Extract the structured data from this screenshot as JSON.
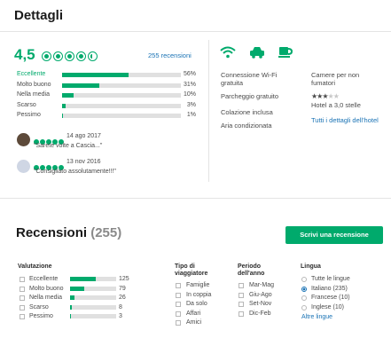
{
  "details": {
    "title": "Dettagli",
    "rating_value": "4,5",
    "rating_bubbles": 4.5,
    "reviews_count_link": "255 recensioni",
    "breakdown": [
      {
        "label": "Eccellente",
        "percent": "56%",
        "fraction": 0.56
      },
      {
        "label": "Molto buono",
        "percent": "31%",
        "fraction": 0.31
      },
      {
        "label": "Nella media",
        "percent": "10%",
        "fraction": 0.1
      },
      {
        "label": "Scarso",
        "percent": "3%",
        "fraction": 0.03
      },
      {
        "label": "Pessimo",
        "percent": "1%",
        "fraction": 0.01
      }
    ],
    "snippets": [
      {
        "date": "14 ago 2017",
        "quote": "\"Sarete volte a Cascia...\"",
        "rating": 5
      },
      {
        "date": "13 nov 2016",
        "quote": "\"Consigliato assolutamente!!!\"",
        "rating": 5
      }
    ],
    "amenity_icons": [
      "wifi-icon",
      "car-icon",
      "coffee-cup-icon"
    ],
    "amenities_left": [
      "Connessione Wi-Fi gratuita",
      "Parcheggio gratuito",
      "Colazione inclusa",
      "Aria condizionata"
    ],
    "amenities_right": [
      "Camere per non fumatori"
    ],
    "hotel_stars": 3,
    "hotel_class": "Hotel a 3,0 stelle",
    "all_details_link": "Tutti i dettagli dell'hotel"
  },
  "reviews": {
    "title": "Recensioni",
    "count": "(255)",
    "write_button": "Scrivi una recensione",
    "valutazione": {
      "header": "Valutazione",
      "items": [
        {
          "label": "Eccellente",
          "count": "125",
          "fraction": 0.56
        },
        {
          "label": "Molto buono",
          "count": "79",
          "fraction": 0.31
        },
        {
          "label": "Nella media",
          "count": "26",
          "fraction": 0.1
        },
        {
          "label": "Scarso",
          "count": "8",
          "fraction": 0.03
        },
        {
          "label": "Pessimo",
          "count": "3",
          "fraction": 0.01
        }
      ]
    },
    "tipo": {
      "header_line1": "Tipo di",
      "header_line2": "viaggiatore",
      "items": [
        "Famiglie",
        "In coppia",
        "Da solo",
        "Affari",
        "Amici"
      ]
    },
    "periodo": {
      "header_line1": "Periodo",
      "header_line2": "dell'anno",
      "items": [
        "Mar-Mag",
        "Giu-Ago",
        "Set-Nov",
        "Dic-Feb"
      ]
    },
    "lingua": {
      "header": "Lingua",
      "items": [
        {
          "label": "Tutte le lingue",
          "selected": false
        },
        {
          "label": "Italiano (235)",
          "selected": true
        },
        {
          "label": "Francese (10)",
          "selected": false
        },
        {
          "label": "Inglese (10)",
          "selected": false
        }
      ],
      "more_link": "Altre lingue"
    }
  },
  "colors": {
    "accent": "#00aa6c",
    "link": "#1a73b5"
  }
}
